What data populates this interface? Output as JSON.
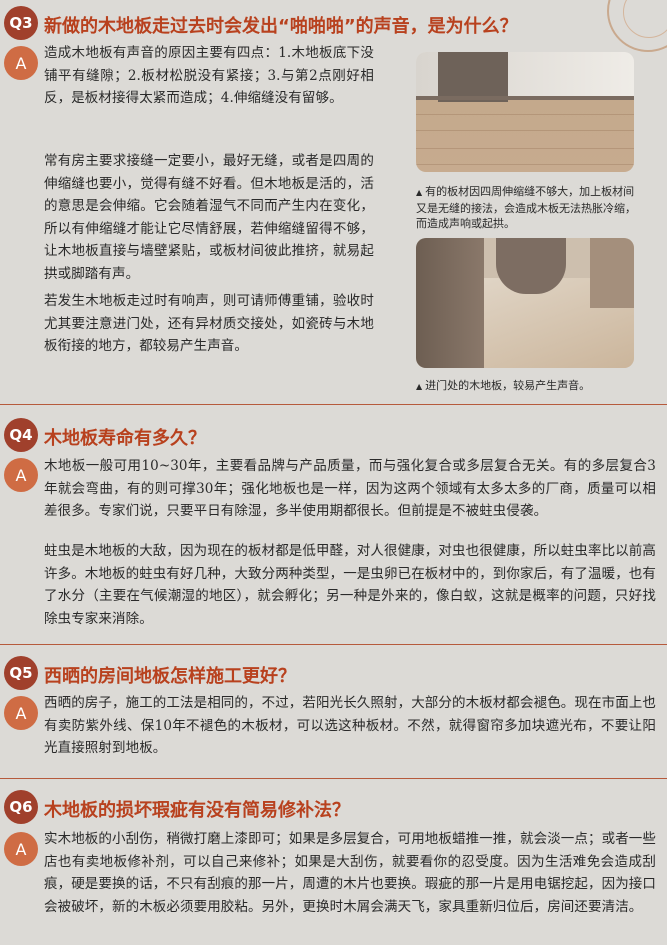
{
  "q3": {
    "badge": "Q3",
    "title": "新做的木地板走过去时会发出“啪啪啪”的声音，是为什么？",
    "answer_badge": "A",
    "paragraphs": [
      "造成木地板有声音的原因主要有四点：1.木地板底下没铺平有缝隙；2.板材松脱没有紧接；3.与第2点刚好相反，是板材接得太紧而造成；4.伸缩缝没有留够。",
      "常有房主要求接缝一定要小，最好无缝，或者是四周的伸缩缝也要小，觉得有缝不好看。但木地板是活的，活的意思是会伸缩。它会随着湿气不同而产生内在变化，所以有伸缩缝才能让它尽情舒展，若伸缩缝留得不够，让木地板直接与墙壁紧贴，或板材间彼此推挤，就易起拱或脚踏有声。",
      "若发生木地板走过时有响声，则可请师傅重铺，验收时尤其要注意进门处，还有异材质交接处，如瓷砖与木地板衔接的地方，都较易产生声音。"
    ],
    "caption1": "有的板材因四周伸缩缝不够大，加上板材间又是无缝的接法，会造成木板无法热胀冷缩，而造成声响或起拱。",
    "caption2": "进门处的木地板，较易产生声音。"
  },
  "q4": {
    "badge": "Q4",
    "title": "木地板寿命有多久？",
    "answer_badge": "A",
    "paragraphs": [
      "木地板一般可用10~30年，主要看品牌与产品质量，而与强化复合或多层复合无关。有的多层复合3年就会弯曲，有的则可撑30年；强化地板也是一样，因为这两个领域有太多太多的厂商，质量可以相差很多。专家们说，只要平日有除湿，多半使用期都很长。但前提是不被蛀虫侵袭。",
      "蛀虫是木地板的大敌，因为现在的板材都是低甲醛，对人很健康，对虫也很健康，所以蛀虫率比以前高许多。木地板的蛀虫有好几种，大致分两种类型，一是虫卵已在板材中的，到你家后，有了温暖，也有了水分（主要在气候潮湿的地区），就会孵化；另一种是外来的，像白蚁，这就是概率的问题，只好找除虫专家来消除。"
    ]
  },
  "q5": {
    "badge": "Q5",
    "title": "西晒的房间地板怎样施工更好？",
    "answer_badge": "A",
    "paragraphs": [
      "西晒的房子，施工的工法是相同的，不过，若阳光长久照射，大部分的木板材都会褪色。现在市面上也有卖防紫外线、保10年不褪色的木板材，可以选这种板材。不然，就得窗帘多加块遮光布，不要让阳光直接照射到地板。"
    ]
  },
  "q6": {
    "badge": "Q6",
    "title": "木地板的损坏瑕疵有没有简易修补法？",
    "answer_badge": "A",
    "paragraphs": [
      "实木地板的小刮伤，稍微打磨上漆即可；如果是多层复合，可用地板蜡推一推，就会淡一点；或者一些店也有卖地板修补剂，可以自己来修补；如果是大刮伤，就要看你的忍受度。因为生活难免会造成刮痕，硬是要换的话，不只有刮痕的那一片，周遭的木片也要换。瑕疵的那一片是用电锯挖起，因为接口会被破坏，新的木板必须要用胶粘。另外，更换时木屑会满天飞，家具重新归位后，房间还要清洁。"
    ]
  }
}
